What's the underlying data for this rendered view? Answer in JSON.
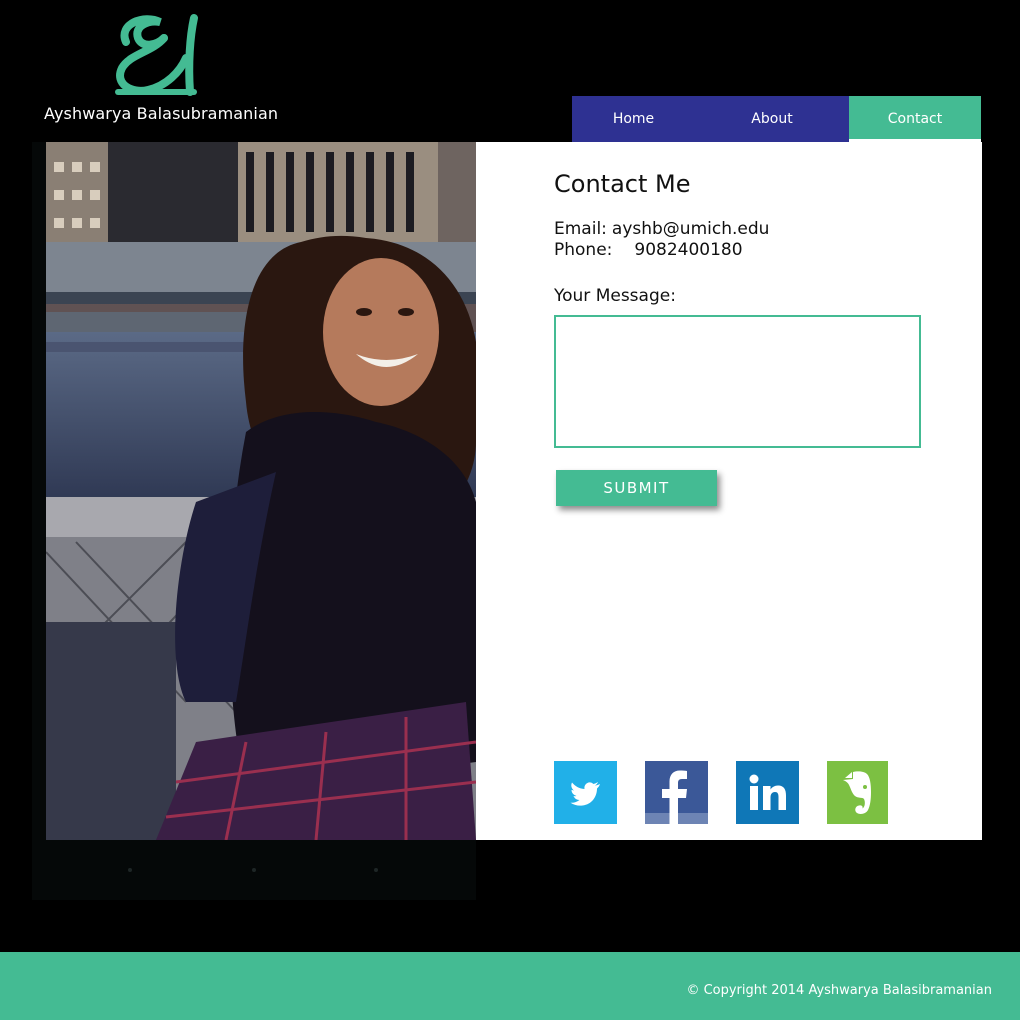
{
  "brand": {
    "name": "Ayshwarya Balasubramanian",
    "accent": "#44bb93",
    "nav_color": "#2e3192"
  },
  "nav": {
    "tabs": [
      {
        "label": "Home",
        "active": false
      },
      {
        "label": "About",
        "active": false
      },
      {
        "label": "Contact",
        "active": true
      }
    ]
  },
  "contact": {
    "title": "Contact Me",
    "email_label": "Email:",
    "email": "ayshb@umich.edu",
    "phone_label": "Phone:",
    "phone": "9082400180",
    "message_label": "Your Message:",
    "message_value": "",
    "submit_label": "SUBMIT"
  },
  "social": [
    {
      "icon": "twitter-icon",
      "color": "#21b0e8"
    },
    {
      "icon": "facebook-icon",
      "color": "#3b5898"
    },
    {
      "icon": "linkedin-icon",
      "color": "#0f77b7"
    },
    {
      "icon": "evernote-icon",
      "color": "#7cc042"
    }
  ],
  "footer": {
    "copyright": "© Copyright 2014  Ayshwarya Balasibramanian"
  }
}
